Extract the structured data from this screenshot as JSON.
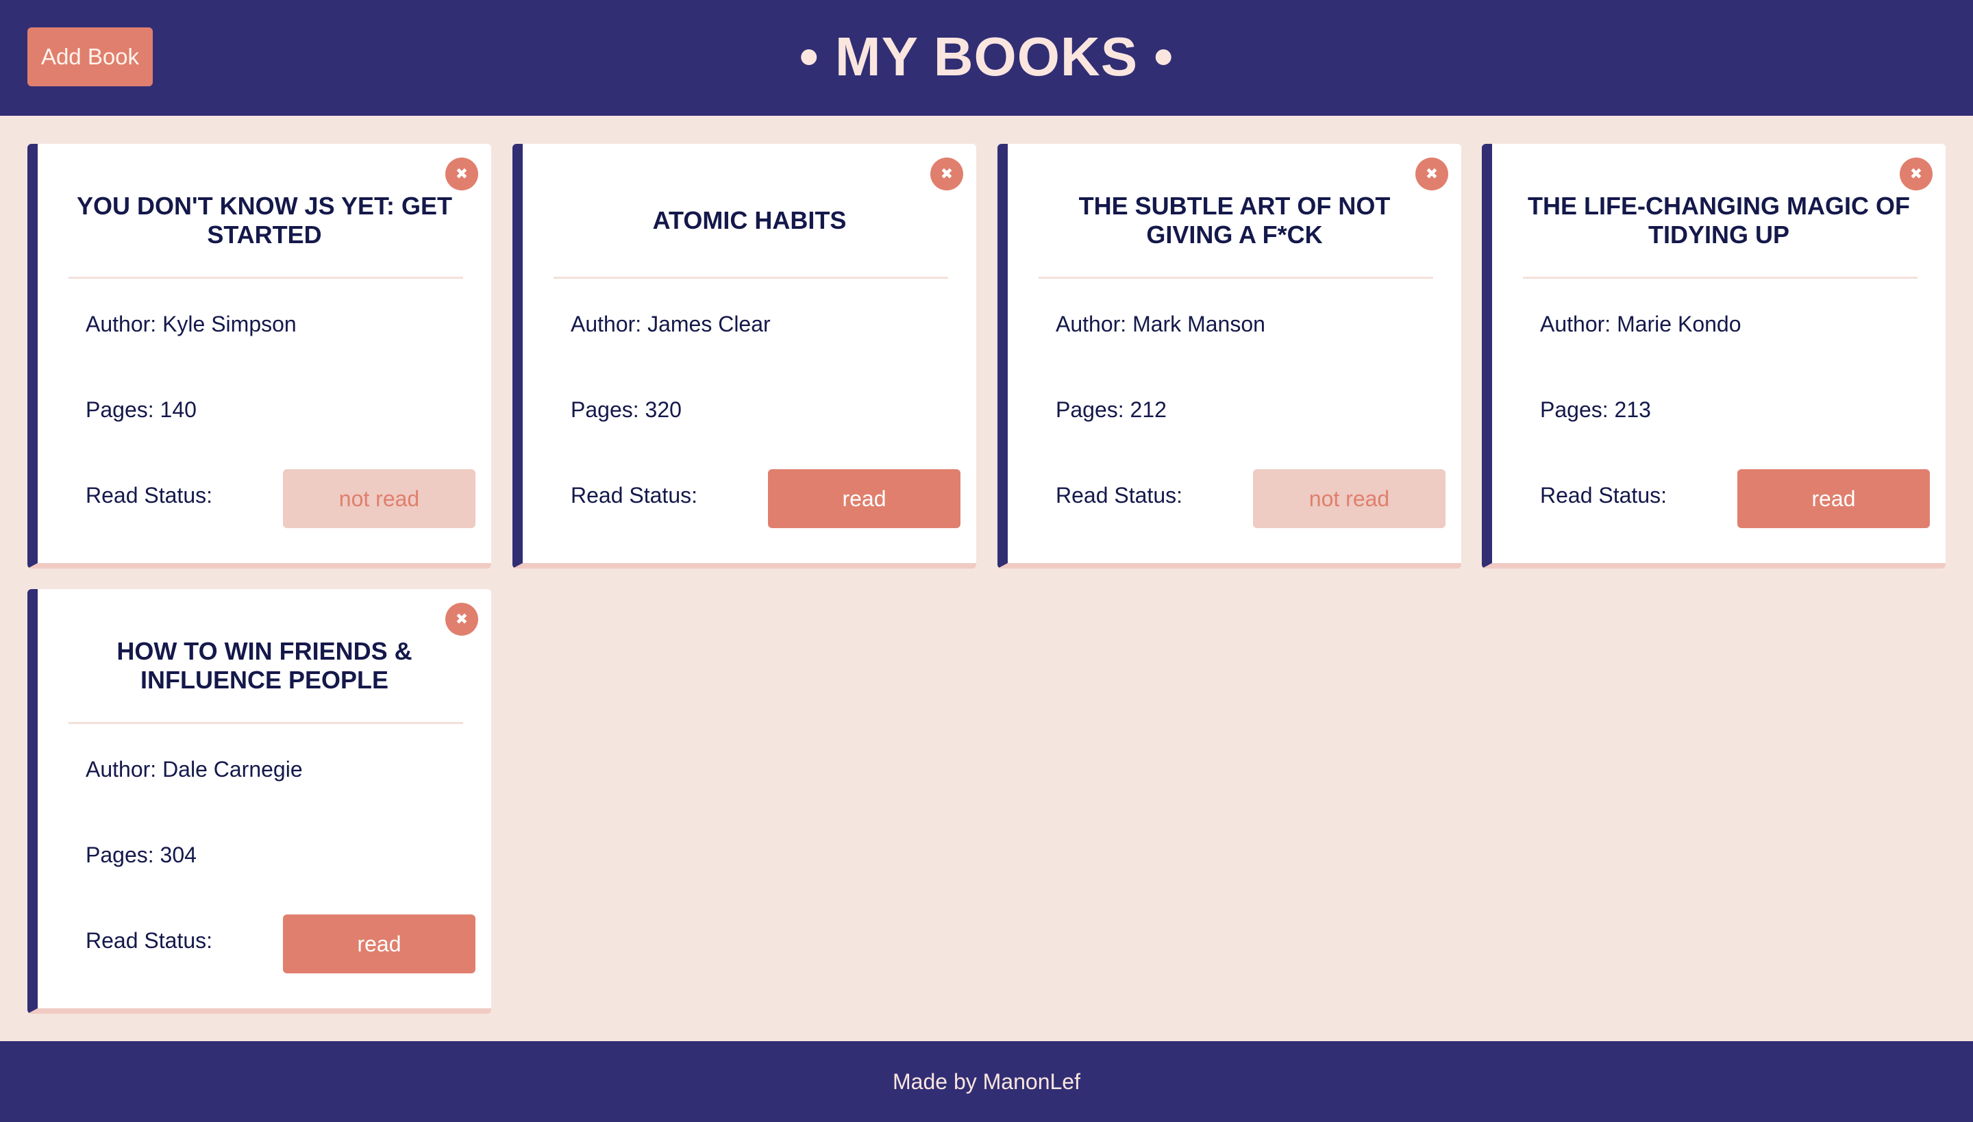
{
  "header": {
    "add_book_label": "Add Book",
    "title": "• MY BOOKS •"
  },
  "books": [
    {
      "title": "You don't know JS yet: Get started",
      "author": "Author: Kyle Simpson",
      "pages": "Pages: 140",
      "status_label": "Read Status:",
      "status": "not read",
      "read": false
    },
    {
      "title": "Atomic Habits",
      "author": "Author: James Clear",
      "pages": "Pages: 320",
      "status_label": "Read Status:",
      "status": "read",
      "read": true
    },
    {
      "title": "The Subtle Art of Not Giving a F*ck",
      "author": "Author: Mark Manson",
      "pages": "Pages: 212",
      "status_label": "Read Status:",
      "status": "not read",
      "read": false
    },
    {
      "title": "The Life-Changing Magic of Tidying Up",
      "author": "Author: Marie Kondo",
      "pages": "Pages: 213",
      "status_label": "Read Status:",
      "status": "read",
      "read": true
    },
    {
      "title": "How to Win Friends & Influence People",
      "author": "Author: Dale Carnegie",
      "pages": "Pages: 304",
      "status_label": "Read Status:",
      "status": "read",
      "read": true
    }
  ],
  "close_icon": "✖",
  "footer": {
    "text": "Made by ManonLef"
  },
  "colors": {
    "navy": "#312e74",
    "coral": "#e07f6d",
    "background": "#f5e5df"
  }
}
